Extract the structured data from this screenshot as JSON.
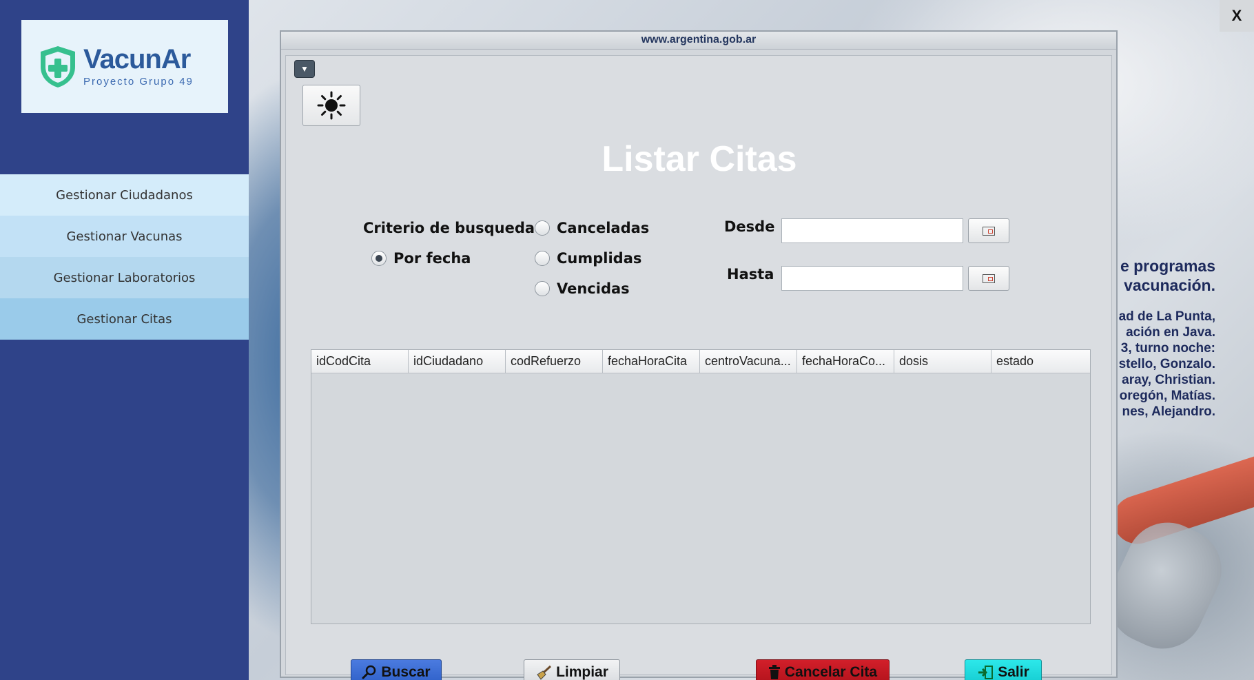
{
  "window": {
    "close_label": "X",
    "frame_title": "www.argentina.gob.ar"
  },
  "sidebar": {
    "logo_title": "VacunAr",
    "logo_subtitle": "Proyecto Grupo 49",
    "items": [
      {
        "label": "Gestionar Ciudadanos",
        "bg": "#d4ecfa"
      },
      {
        "label": "Gestionar Vacunas",
        "bg": "#c2e1f6"
      },
      {
        "label": "Gestionar Laboratorios",
        "bg": "#b4d8ef"
      },
      {
        "label": "Gestionar Citas",
        "bg": "#9acbea"
      }
    ]
  },
  "side_text": {
    "line1": "e programas",
    "line2": "vacunación.",
    "credits": [
      "ad de La Punta,",
      "ación en Java.",
      "3, turno noche:",
      "stello, Gonzalo.",
      "aray, Christian.",
      "oregón, Matías.",
      "nes, Alejandro."
    ]
  },
  "main": {
    "title": "Listar Citas",
    "criteria_label": "Criterio de busqueda",
    "radios": {
      "por_fecha": "Por fecha",
      "canceladas": "Canceladas",
      "cumplidas": "Cumplidas",
      "vencidas": "Vencidas"
    },
    "selected_radio": "por_fecha",
    "desde_label": "Desde",
    "hasta_label": "Hasta",
    "desde_value": "",
    "hasta_value": ""
  },
  "table": {
    "columns": [
      "idCodCita",
      "idCiudadano",
      "codRefuerzo",
      "fechaHoraCita",
      "centroVacuna...",
      "fechaHoraCo...",
      "dosis",
      "estado"
    ],
    "rows": []
  },
  "buttons": {
    "buscar": "Buscar",
    "limpiar": "Limpiar",
    "cancelar_cita": "Cancelar Cita",
    "salir": "Salir"
  },
  "colors": {
    "sidebar_bg": "#2f4389",
    "buscar": "#2d5fc7",
    "cancelar": "#b0121b",
    "salir": "#14cbd0"
  }
}
